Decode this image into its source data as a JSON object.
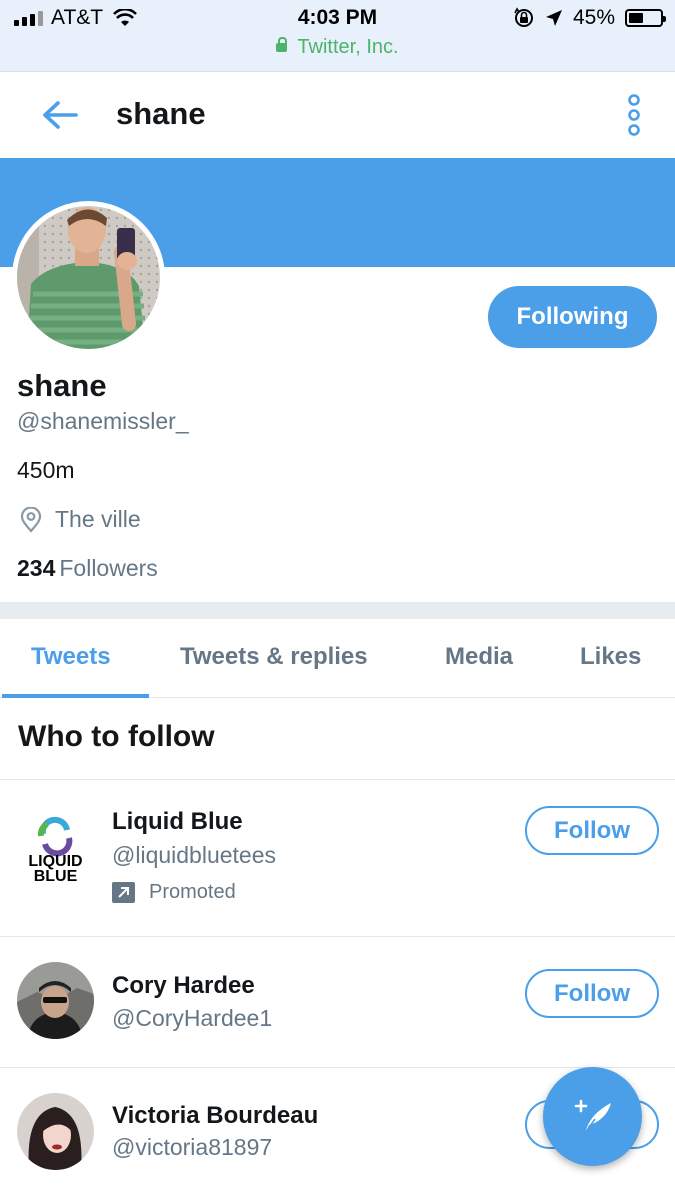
{
  "status_bar": {
    "carrier": "AT&T",
    "time": "4:03 PM",
    "site": "Twitter, Inc.",
    "battery_percent": "45%",
    "battery_level": 0.45,
    "icons": [
      "signal-icon",
      "wifi-icon",
      "orientation-lock-icon",
      "location-arrow-icon",
      "battery-icon",
      "lock-icon"
    ]
  },
  "header": {
    "title": "shane",
    "back_icon": "back-arrow-icon",
    "more_icon": "vertical-dots-icon"
  },
  "profile": {
    "name": "shane",
    "handle": "@shanemissler_",
    "bio": "450m",
    "location": "The ville",
    "followers_count": "234",
    "followers_label": "Followers",
    "following_button": "Following"
  },
  "colors": {
    "accent": "#4b9ee8",
    "text_primary": "#14171a",
    "text_secondary": "#657786",
    "site_green": "#4cb46a"
  },
  "tabs": [
    {
      "label": "Tweets",
      "active": true
    },
    {
      "label": "Tweets & replies",
      "active": false
    },
    {
      "label": "Media",
      "active": false
    },
    {
      "label": "Likes",
      "active": false
    }
  ],
  "who_to_follow": {
    "title": "Who to follow",
    "items": [
      {
        "name": "Liquid Blue",
        "handle": "@liquidbluetees",
        "promoted": "Promoted",
        "button": "Follow",
        "logo_text_top": "LIQUID",
        "logo_text_bottom": "BLUE"
      },
      {
        "name": "Cory Hardee",
        "handle": "@CoryHardee1",
        "button": "Follow"
      },
      {
        "name": "Victoria Bourdeau",
        "handle": "@victoria81897",
        "button": "Follow"
      }
    ]
  },
  "fab": {
    "icon": "compose-tweet-icon"
  }
}
